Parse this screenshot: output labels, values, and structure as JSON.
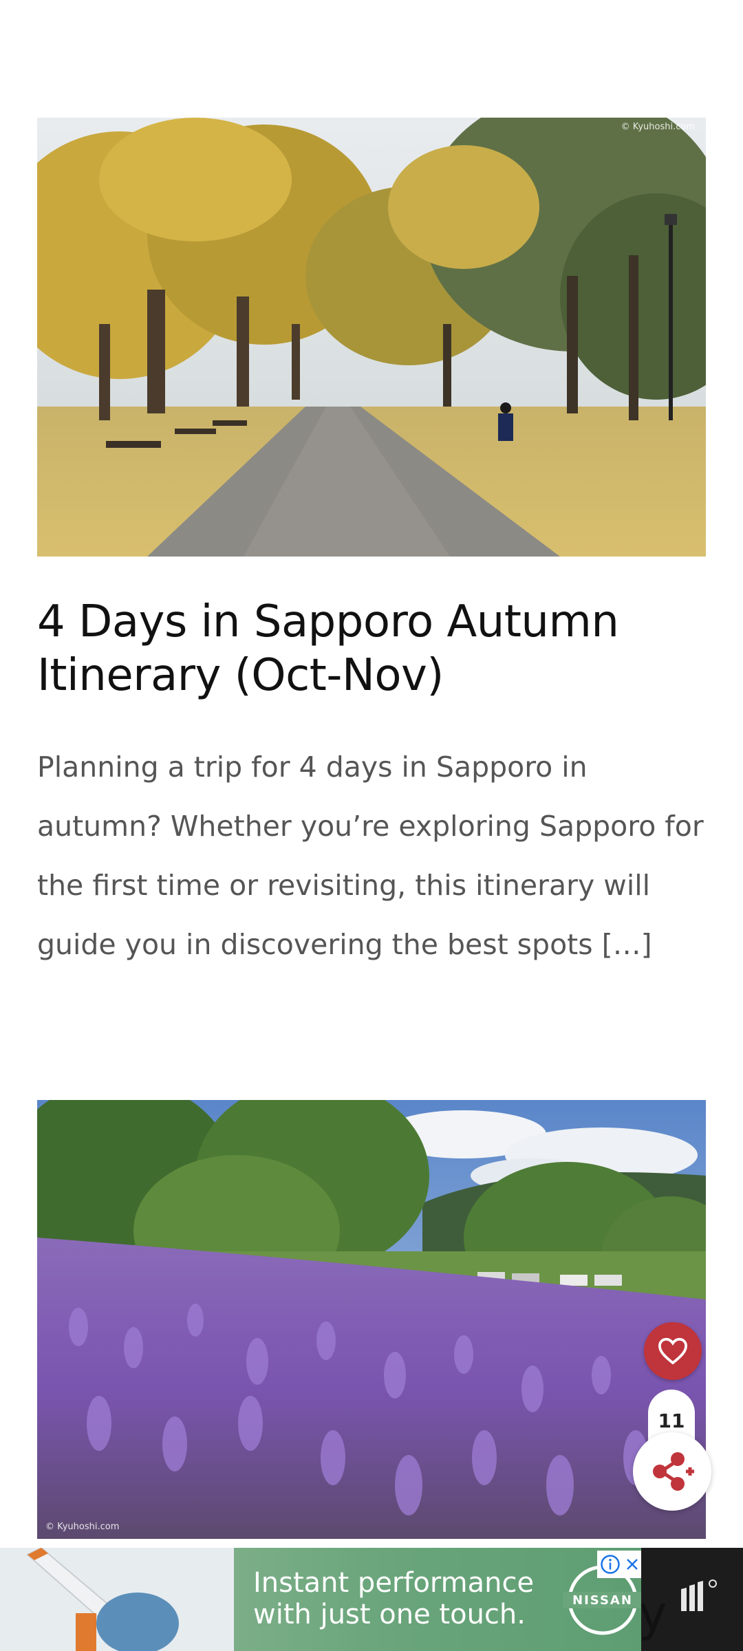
{
  "posts": [
    {
      "image_alt": "Autumn park with yellow ginkgo trees, benches and a person walking",
      "watermark": "© Kyuhoshi.com",
      "title": "4 Days in Sapporo Autumn Itinerary (Oct-Nov)",
      "excerpt": "Planning a trip for 4 days in Sapporo in autumn? Whether you’re exploring Sapporo for the first time or revisiting, this itinerary will guide you in discovering the best spots […]"
    },
    {
      "image_alt": "Lavender field with green trees and parked cars under a blue sky",
      "watermark": "© Kyuhoshi.com"
    }
  ],
  "floating_actions": {
    "favorite_icon": "heart-icon",
    "share_count": "11",
    "share_icon": "share-icon"
  },
  "ad": {
    "headline": "Instant performance\nwith just one touch.",
    "brand": "NISSAN",
    "info_icon": "info-icon",
    "close_icon": "close-icon"
  },
  "colors": {
    "favorite_red": "#c0343b",
    "title_text": "#111111",
    "excerpt_text": "#555555",
    "ad_green": "#6aa57b"
  }
}
